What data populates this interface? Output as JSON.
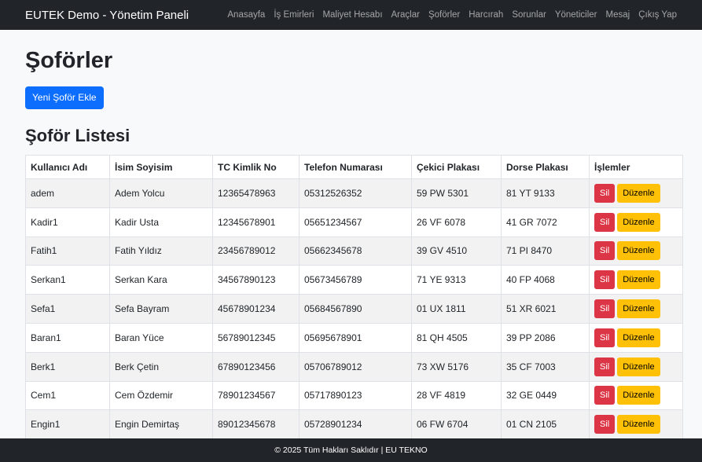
{
  "navbar": {
    "brand": "EUTEK Demo - Yönetim Paneli",
    "links": [
      "Anasayfa",
      "İş Emirleri",
      "Maliyet Hesabı",
      "Araçlar",
      "Şoförler",
      "Harcırah",
      "Sorunlar",
      "Yöneticiler",
      "Mesaj",
      "Çıkış Yap"
    ]
  },
  "page": {
    "title": "Şoförler",
    "add_button": "Yeni Şoför Ekle",
    "list_title": "Şoför Listesi"
  },
  "table": {
    "headers": [
      "Kullanıcı Adı",
      "İsim Soyisim",
      "TC Kimlik No",
      "Telefon Numarası",
      "Çekici Plakası",
      "Dorse Plakası",
      "İşlemler"
    ],
    "delete_label": "Sil",
    "edit_label": "Düzenle",
    "rows": [
      [
        "adem",
        "Adem Yolcu",
        "12365478963",
        "05312526352",
        "59 PW 5301",
        "81 YT 9133"
      ],
      [
        "Kadir1",
        "Kadir Usta",
        "12345678901",
        "05651234567",
        "26 VF 6078",
        "41 GR 7072"
      ],
      [
        "Fatih1",
        "Fatih Yıldız",
        "23456789012",
        "05662345678",
        "39 GV 4510",
        "71 PI 8470"
      ],
      [
        "Serkan1",
        "Serkan Kara",
        "34567890123",
        "05673456789",
        "71 YE 9313",
        "40 FP 4068"
      ],
      [
        "Sefa1",
        "Sefa Bayram",
        "45678901234",
        "05684567890",
        "01 UX 1811",
        "51 XR 6021"
      ],
      [
        "Baran1",
        "Baran Yüce",
        "56789012345",
        "05695678901",
        "81 QH 4505",
        "39 PP 2086"
      ],
      [
        "Berk1",
        "Berk Çetin",
        "67890123456",
        "05706789012",
        "73 XW 5176",
        "35 CF 7003"
      ],
      [
        "Cem1",
        "Cem Özdemir",
        "78901234567",
        "05717890123",
        "28 VF 4819",
        "32 GE 0449"
      ],
      [
        "Engin1",
        "Engin Demirtaş",
        "89012345678",
        "05728901234",
        "06 FW 6704",
        "01 CN 2105"
      ]
    ]
  },
  "footer": {
    "text": "© 2025 Tüm Hakları Saklıdır | EU TEKNO"
  },
  "colors": {
    "navbar": "#212529",
    "primary": "#0d6efd",
    "danger": "#dc3545",
    "warning": "#ffc107"
  }
}
